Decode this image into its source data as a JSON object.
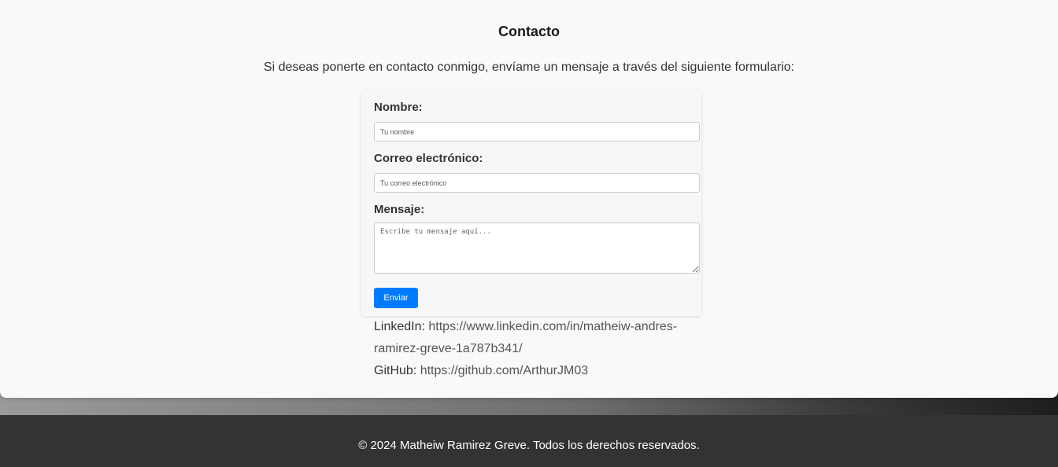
{
  "contact": {
    "title": "Contacto",
    "intro": "Si deseas ponerte en contacto conmigo, envíame un mensaje a través del siguiente formulario:"
  },
  "form": {
    "name_label": "Nombre:",
    "name_placeholder": "Tu nombre",
    "email_label": "Correo electrónico:",
    "email_placeholder": "Tu correo electrónico",
    "message_label": "Mensaje:",
    "message_placeholder": "Escribe tu mensaje aquí...",
    "submit_label": "Enviar"
  },
  "links": {
    "linkedin_label": "LinkedIn:",
    "linkedin_url": "https://www.linkedin.com/in/matheiw-andres-ramirez-greve-1a787b341/",
    "github_label": "GitHub:",
    "github_url": "https://github.com/ArthurJM03"
  },
  "footer": {
    "copyright": "© 2024 Matheiw Ramirez Greve. Todos los derechos reservados."
  },
  "colors": {
    "accent": "#007bff",
    "footer_bg": "#333333",
    "card_bg": "#f9f9f9"
  }
}
